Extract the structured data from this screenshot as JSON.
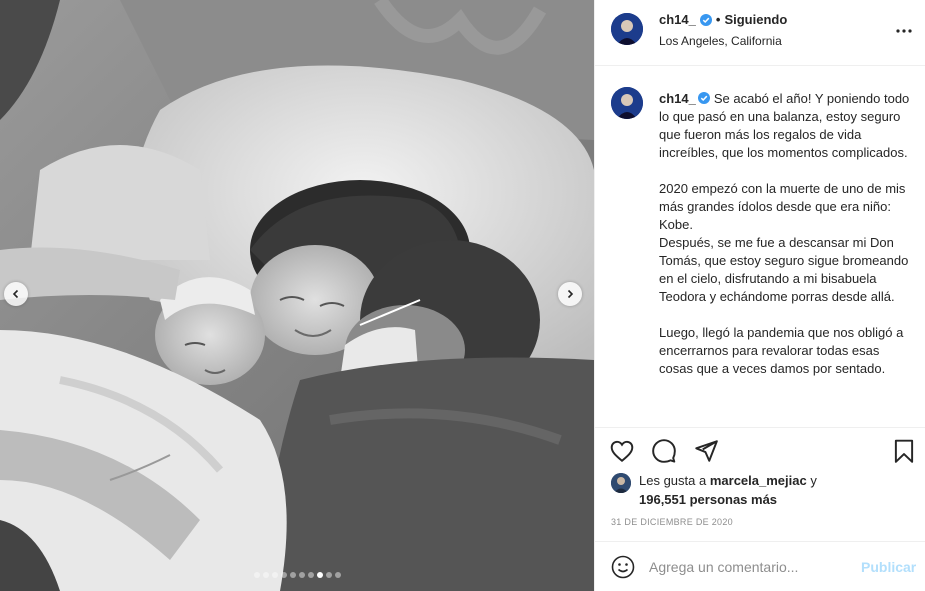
{
  "post": {
    "username": "ch14_",
    "separator": "•",
    "follow_label": "Siguiendo",
    "location": "Los Angeles, California",
    "more_icon": "more-horizontal-icon",
    "photo_dots": {
      "count": 10,
      "active_index": 7
    }
  },
  "caption": {
    "username": "ch14_",
    "first_line": "Se acabó el año! Y poniendo todo lo que pasó en una balanza, estoy seguro que fueron más los regalos de vida increíbles, que los momentos complicados.",
    "para2": "2020 empezó con la muerte de uno de mis más grandes ídolos desde que era niño: Kobe.",
    "para3": "Después, se me fue a descansar mi Don Tomás, que estoy seguro sigue bromeando en el cielo, disfrutando a mi bisabuela Teodora y echándome porras desde allá.",
    "para4": "Luego, llegó la pandemia que nos obligó a encerrarnos para revalorar todas esas cosas que a veces damos por sentado."
  },
  "likes": {
    "prefix": "Les gusta a",
    "user": "marcela_mejiac",
    "connector": "y",
    "count": "196,551 personas más"
  },
  "date": "31 DE DICIEMBRE DE 2020",
  "comment": {
    "placeholder": "Agrega un comentario...",
    "publish_label": "Publicar"
  },
  "colors": {
    "verified": "#3897f0",
    "publish_disabled": "#b2dffc",
    "muted": "#8e8e8e"
  }
}
